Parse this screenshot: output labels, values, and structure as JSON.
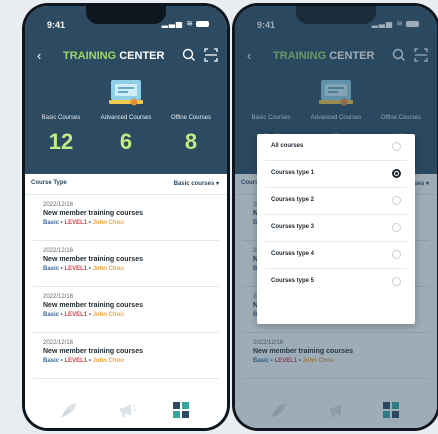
{
  "status": {
    "time": "9:41"
  },
  "header": {
    "title_highlight": "TRAINING",
    "title_rest": " CENTER"
  },
  "stats": [
    {
      "label": "Basic Courses",
      "value": "12"
    },
    {
      "label": "Advanced Courses",
      "value": "6"
    },
    {
      "label": "Offine Courses",
      "value": "8"
    }
  ],
  "filter": {
    "label": "Course Type",
    "value": "Basic courses ▾"
  },
  "courses": [
    {
      "date": "2022/12/16",
      "title": "New member training courses",
      "type": "Basic",
      "level": "LEVEL1",
      "author": "John Chou"
    },
    {
      "date": "2022/12/16",
      "title": "New member training courses",
      "type": "Basic",
      "level": "LEVEL1",
      "author": "John Chou"
    },
    {
      "date": "2022/12/16",
      "title": "New member training courses",
      "type": "Basic",
      "level": "LEVEL1",
      "author": "John Chou"
    },
    {
      "date": "2022/12/16",
      "title": "New member training courses",
      "type": "Basic",
      "level": "LEVEL1",
      "author": "John Chou"
    }
  ],
  "dropdown": {
    "options": [
      "All courses",
      "Courses type 1",
      "Courses type 2",
      "Courses type 3",
      "Courses type 4",
      "Courses type 5"
    ],
    "selected_index": 1
  },
  "colors": {
    "header": "#2c4a62",
    "accent": "#9bd86a",
    "level": "#d8434b",
    "author": "#f3a33a"
  },
  "icons": {
    "tabs": [
      "leaf-icon",
      "megaphone-icon",
      "dashboard-icon"
    ]
  }
}
